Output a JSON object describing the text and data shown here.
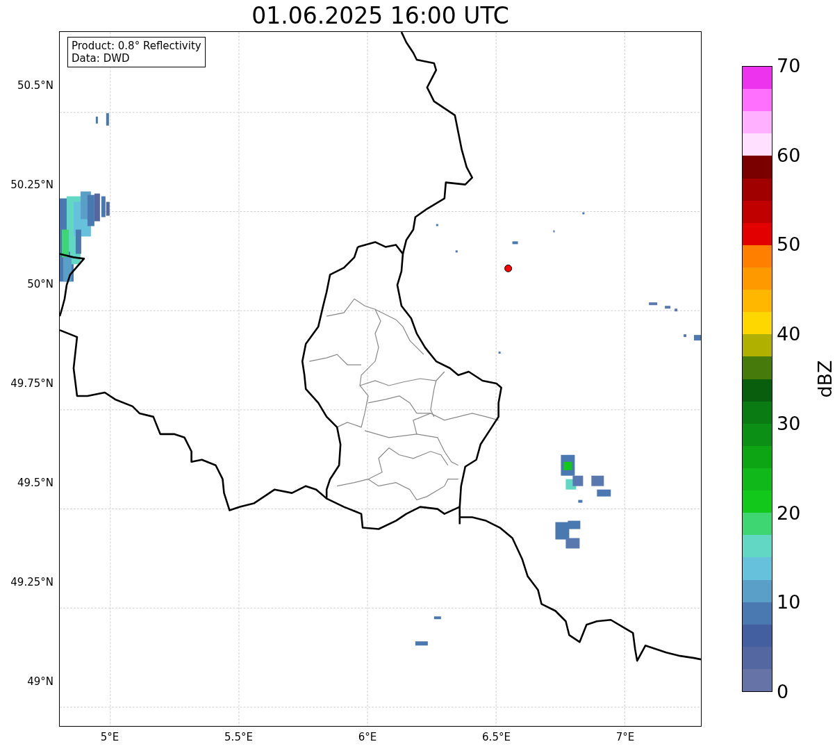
{
  "title": "01.06.2025 16:00 UTC",
  "map": {
    "info_box": [
      "Product: 0.8° Reflectivity",
      "Data: DWD"
    ],
    "xticks": [
      "5°E",
      "5.5°E",
      "6°E",
      "6.5°E",
      "7°E"
    ],
    "yticks": [
      "50.5°N",
      "50.25°N",
      "50°N",
      "49.75°N",
      "49.5°N",
      "49.25°N",
      "49°N"
    ]
  },
  "colorbar": {
    "label": "dBZ",
    "ticks": [
      "70",
      "60",
      "50",
      "40",
      "30",
      "20",
      "10",
      "0"
    ],
    "bands": [
      {
        "color": "#ee33ee"
      },
      {
        "color": "#ff70ff"
      },
      {
        "color": "#ffb0ff"
      },
      {
        "color": "#ffe0ff"
      },
      {
        "color": "#7a0000"
      },
      {
        "color": "#a00000"
      },
      {
        "color": "#c00000"
      },
      {
        "color": "#e20000"
      },
      {
        "color": "#ff7f00"
      },
      {
        "color": "#ff9900"
      },
      {
        "color": "#ffb700"
      },
      {
        "color": "#ffd700"
      },
      {
        "color": "#b0b000"
      },
      {
        "color": "#467a0a"
      },
      {
        "color": "#085e0c"
      },
      {
        "color": "#0a7a12"
      },
      {
        "color": "#0b8f14"
      },
      {
        "color": "#0ea514"
      },
      {
        "color": "#10b81a"
      },
      {
        "color": "#12c81a"
      },
      {
        "color": "#3ed672"
      },
      {
        "color": "#62d8c4"
      },
      {
        "color": "#66c2dc"
      },
      {
        "color": "#5a9fc8"
      },
      {
        "color": "#4a78b0"
      },
      {
        "color": "#435fa0"
      },
      {
        "color": "#5467a0"
      },
      {
        "color": "#6673a6"
      }
    ]
  }
}
